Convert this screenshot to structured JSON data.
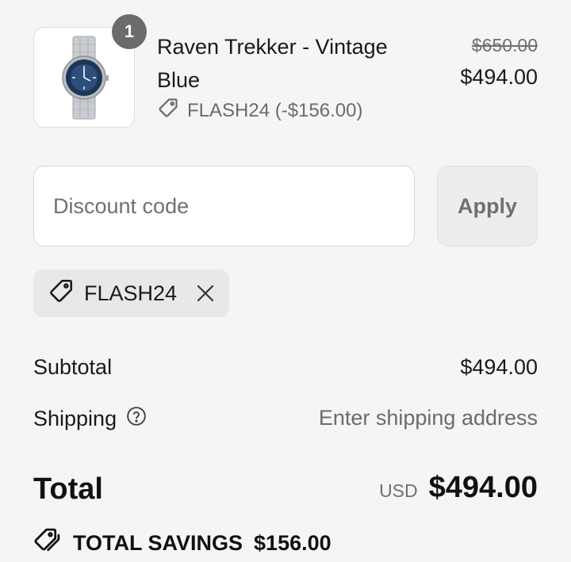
{
  "product": {
    "quantity": "1",
    "name": "Raven Trekker - Vintage Blue",
    "discount_text": "FLASH24 (-$156.00)",
    "price_original": "$650.00",
    "price_current": "$494.00",
    "image_icon": "watch-image"
  },
  "discount_form": {
    "placeholder": "Discount code",
    "value": "",
    "apply_label": "Apply"
  },
  "applied_discount": {
    "code": "FLASH24",
    "tag_icon": "tag-icon",
    "remove_icon": "close-icon"
  },
  "summary": {
    "subtotal_label": "Subtotal",
    "subtotal_value": "$494.00",
    "shipping_label": "Shipping",
    "shipping_value": "Enter shipping address",
    "help_icon": "question-circle-icon",
    "total_label": "Total",
    "currency": "USD",
    "total_value": "$494.00",
    "savings_label": "TOTAL SAVINGS",
    "savings_value": "$156.00",
    "savings_icon": "tags-icon"
  },
  "colors": {
    "background": "#f5f5f5",
    "badge": "#6b6b6b",
    "muted_text": "#707070",
    "chip_bg": "#e8e8e8"
  }
}
